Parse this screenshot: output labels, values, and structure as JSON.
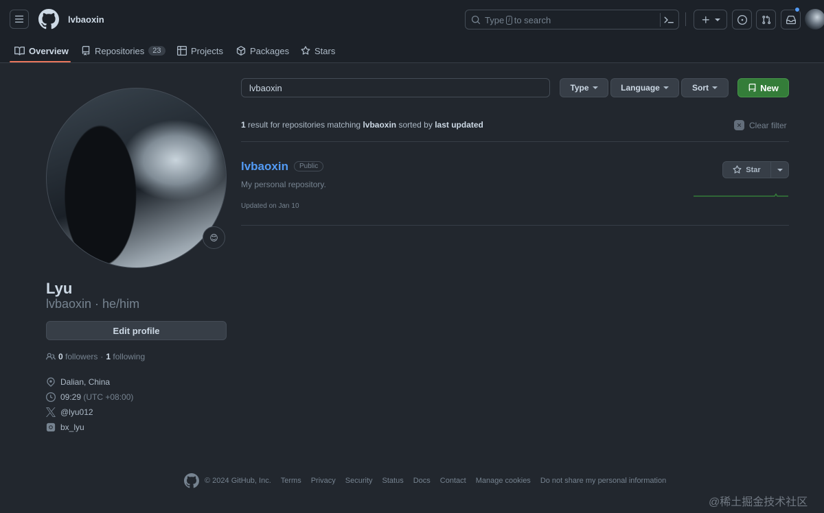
{
  "header": {
    "username": "lvbaoxin",
    "search_prefix": "Type",
    "search_key": "/",
    "search_suffix": "to search"
  },
  "tabs": [
    {
      "label": "Overview"
    },
    {
      "label": "Repositories",
      "count": "23"
    },
    {
      "label": "Projects"
    },
    {
      "label": "Packages"
    },
    {
      "label": "Stars"
    }
  ],
  "profile": {
    "name": "Lyu",
    "login_line": "lvbaoxin · he/him",
    "status_emoji": "😊",
    "edit_label": "Edit profile",
    "followers_count": "0",
    "followers_label": "followers",
    "dot": "·",
    "following_count": "1",
    "following_label": "following",
    "location": "Dalian, China",
    "local_time": "09:29",
    "timezone": "(UTC +08:00)",
    "twitter": "@lyu012",
    "social": "bx_lyu"
  },
  "repos": {
    "search_value": "lvbaoxin",
    "filters": {
      "type": "Type",
      "language": "Language",
      "sort": "Sort"
    },
    "new_label": "New",
    "summary": {
      "count": "1",
      "text1": "result for repositories matching",
      "query": "lvbaoxin",
      "text2": "sorted by",
      "sort": "last updated"
    },
    "clear_filter": "Clear filter",
    "items": [
      {
        "name": "lvbaoxin",
        "visibility": "Public",
        "description": "My personal repository.",
        "updated": "Updated on Jan 10",
        "star_label": "Star"
      }
    ]
  },
  "footer": {
    "copyright": "© 2024 GitHub, Inc.",
    "links": [
      "Terms",
      "Privacy",
      "Security",
      "Status",
      "Docs",
      "Contact",
      "Manage cookies",
      "Do not share my personal information"
    ]
  },
  "watermark": "@稀土掘金技术社区",
  "colors": {
    "background": "#22272e",
    "header": "#1c2128",
    "link": "#539bf5",
    "new_button": "#347d39",
    "tab_underline": "#ec775c"
  }
}
